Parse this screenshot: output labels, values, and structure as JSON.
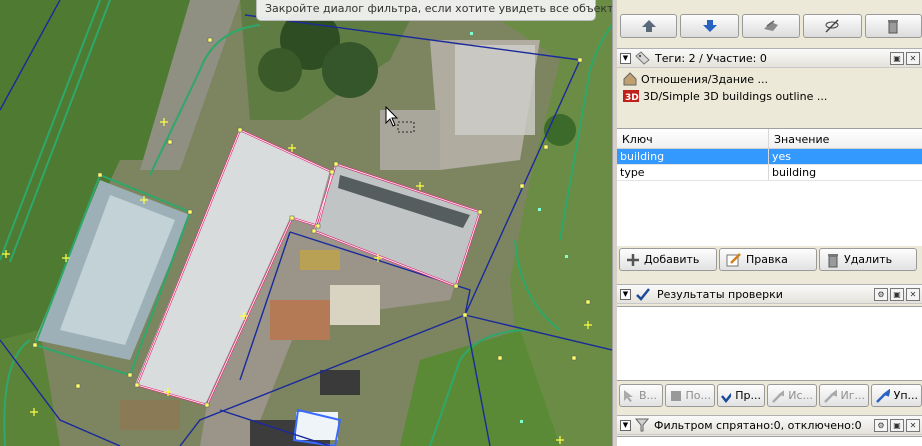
{
  "map": {
    "banner_text": "Закройте диалог фильтра, если хотите увидеть все объекты."
  },
  "toolbar": {
    "buttons": [
      "arrow-up-icon",
      "arrow-down-icon",
      "merge-icon",
      "hide-icon",
      "trash-icon"
    ]
  },
  "tags_panel": {
    "title": "Теги: 2 / Участие: 0",
    "relations": [
      {
        "icon": "relation-icon",
        "text": "Отношения/Здание ..."
      },
      {
        "icon": "3d-preset-icon",
        "text": "3D/Simple 3D buildings outline ..."
      }
    ],
    "columns": {
      "key": "Ключ",
      "value": "Значение"
    },
    "rows": [
      {
        "key": "building",
        "value": "yes",
        "selected": true
      },
      {
        "key": "type",
        "value": "building",
        "selected": false
      }
    ],
    "buttons": {
      "add": "Добавить",
      "edit": "Правка",
      "delete": "Удалить"
    }
  },
  "validation_panel": {
    "title": "Результаты проверки",
    "buttons": {
      "select": "В...",
      "zoom": "По...",
      "validate": "Пр...",
      "fix": "Ис...",
      "ignore": "Иг...",
      "upload": "Уп..."
    }
  },
  "filter_panel": {
    "title": "Фильтром спрятано:0, отключено:0"
  },
  "colors": {
    "selected_row": "#3399ff",
    "selection_outline": "#e0307a",
    "way_blue": "#1a2a9c",
    "way_green": "#2ea86a"
  }
}
